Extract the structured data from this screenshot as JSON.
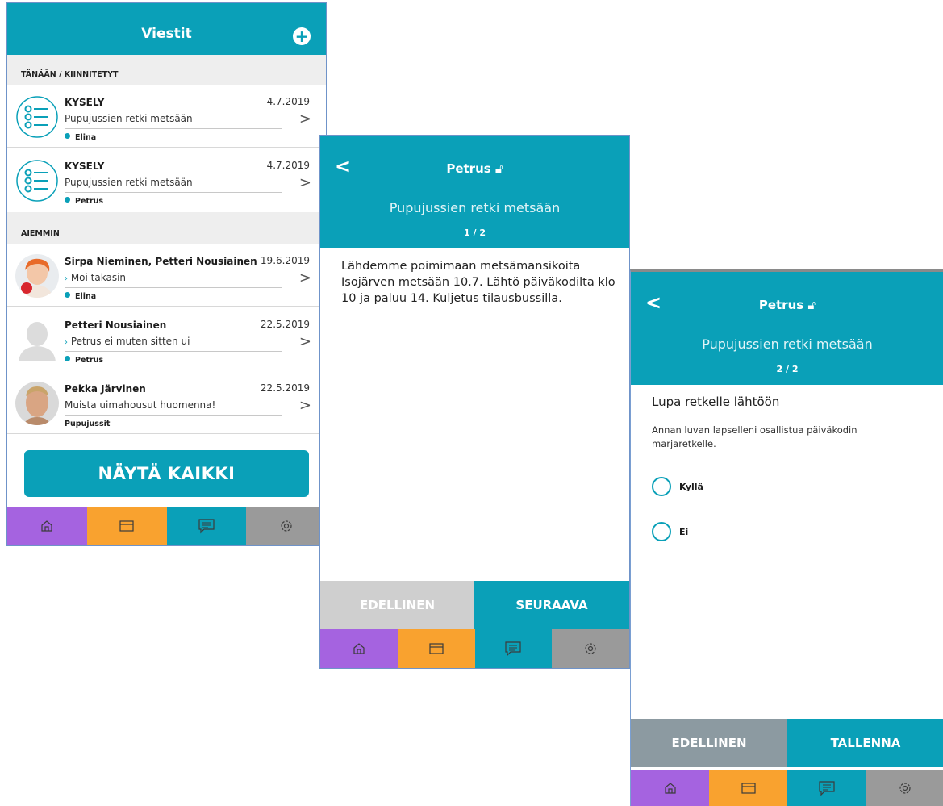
{
  "messages_screen": {
    "title": "Viestit",
    "add_icon": "plus-circle-icon",
    "section_today": "TÄNÄÄN / KIINNITETYT",
    "section_earlier": "AIEMMIN",
    "rows": [
      {
        "name": "KYSELY",
        "date": "4.7.2019",
        "subject": "Pupujussien retki metsään",
        "child": "Elina",
        "has_dot": true,
        "reply": false,
        "avatar": "survey-icon"
      },
      {
        "name": "KYSELY",
        "date": "4.7.2019",
        "subject": "Pupujussien retki metsään",
        "child": "Petrus",
        "has_dot": true,
        "reply": false,
        "avatar": "survey-icon"
      },
      {
        "name": "Sirpa Nieminen, Petteri Nousiainen",
        "date": "19.6.2019",
        "subject": "Moi takasin",
        "child": "Elina",
        "has_dot": true,
        "reply": true,
        "avatar": "photo-woman"
      },
      {
        "name": "Petteri Nousiainen",
        "date": "22.5.2019",
        "subject": "Petrus ei muten sitten ui",
        "child": "Petrus",
        "has_dot": true,
        "reply": true,
        "avatar": "placeholder-person"
      },
      {
        "name": "Pekka Järvinen",
        "date": "22.5.2019",
        "subject": "Muista uimahousut huomenna!",
        "child": "Pupujussit",
        "has_dot": false,
        "reply": false,
        "avatar": "photo-man"
      }
    ],
    "show_all": "NÄYTÄ KAIKKI"
  },
  "survey_page1": {
    "title": "Petrus",
    "subtitle": "Pupujussien retki metsään",
    "pager": "1 / 2",
    "body": "Lähdemme poimimaan metsämansikoita Isojärven metsään 10.7. Lähtö päiväkodilta klo 10 ja paluu 14. Kuljetus tilausbussilla.",
    "prev_label": "EDELLINEN",
    "next_label": "SEURAAVA"
  },
  "survey_page2": {
    "title": "Petrus",
    "subtitle": "Pupujussien retki metsään",
    "pager": "2 / 2",
    "question": "Lupa retkelle lähtöön",
    "description": "Annan luvan lapselleni osallistua päiväkodin marjaretkelle.",
    "options": [
      "Kyllä",
      "Ei"
    ],
    "prev_label": "EDELLINEN",
    "save_label": "TALLENNA"
  },
  "tabbar": {
    "tabs": [
      {
        "icon": "home-icon",
        "color": "#a563e0"
      },
      {
        "icon": "calendar-icon",
        "color": "#f9a22f"
      },
      {
        "icon": "messages-icon",
        "color": "#0aa0b8"
      },
      {
        "icon": "settings-icon",
        "color": "#9a9a9a"
      }
    ]
  },
  "colors": {
    "accent": "#0aa0b8",
    "disabled_button": "#cfcfcf",
    "secondary_button": "#8c9aa1"
  }
}
